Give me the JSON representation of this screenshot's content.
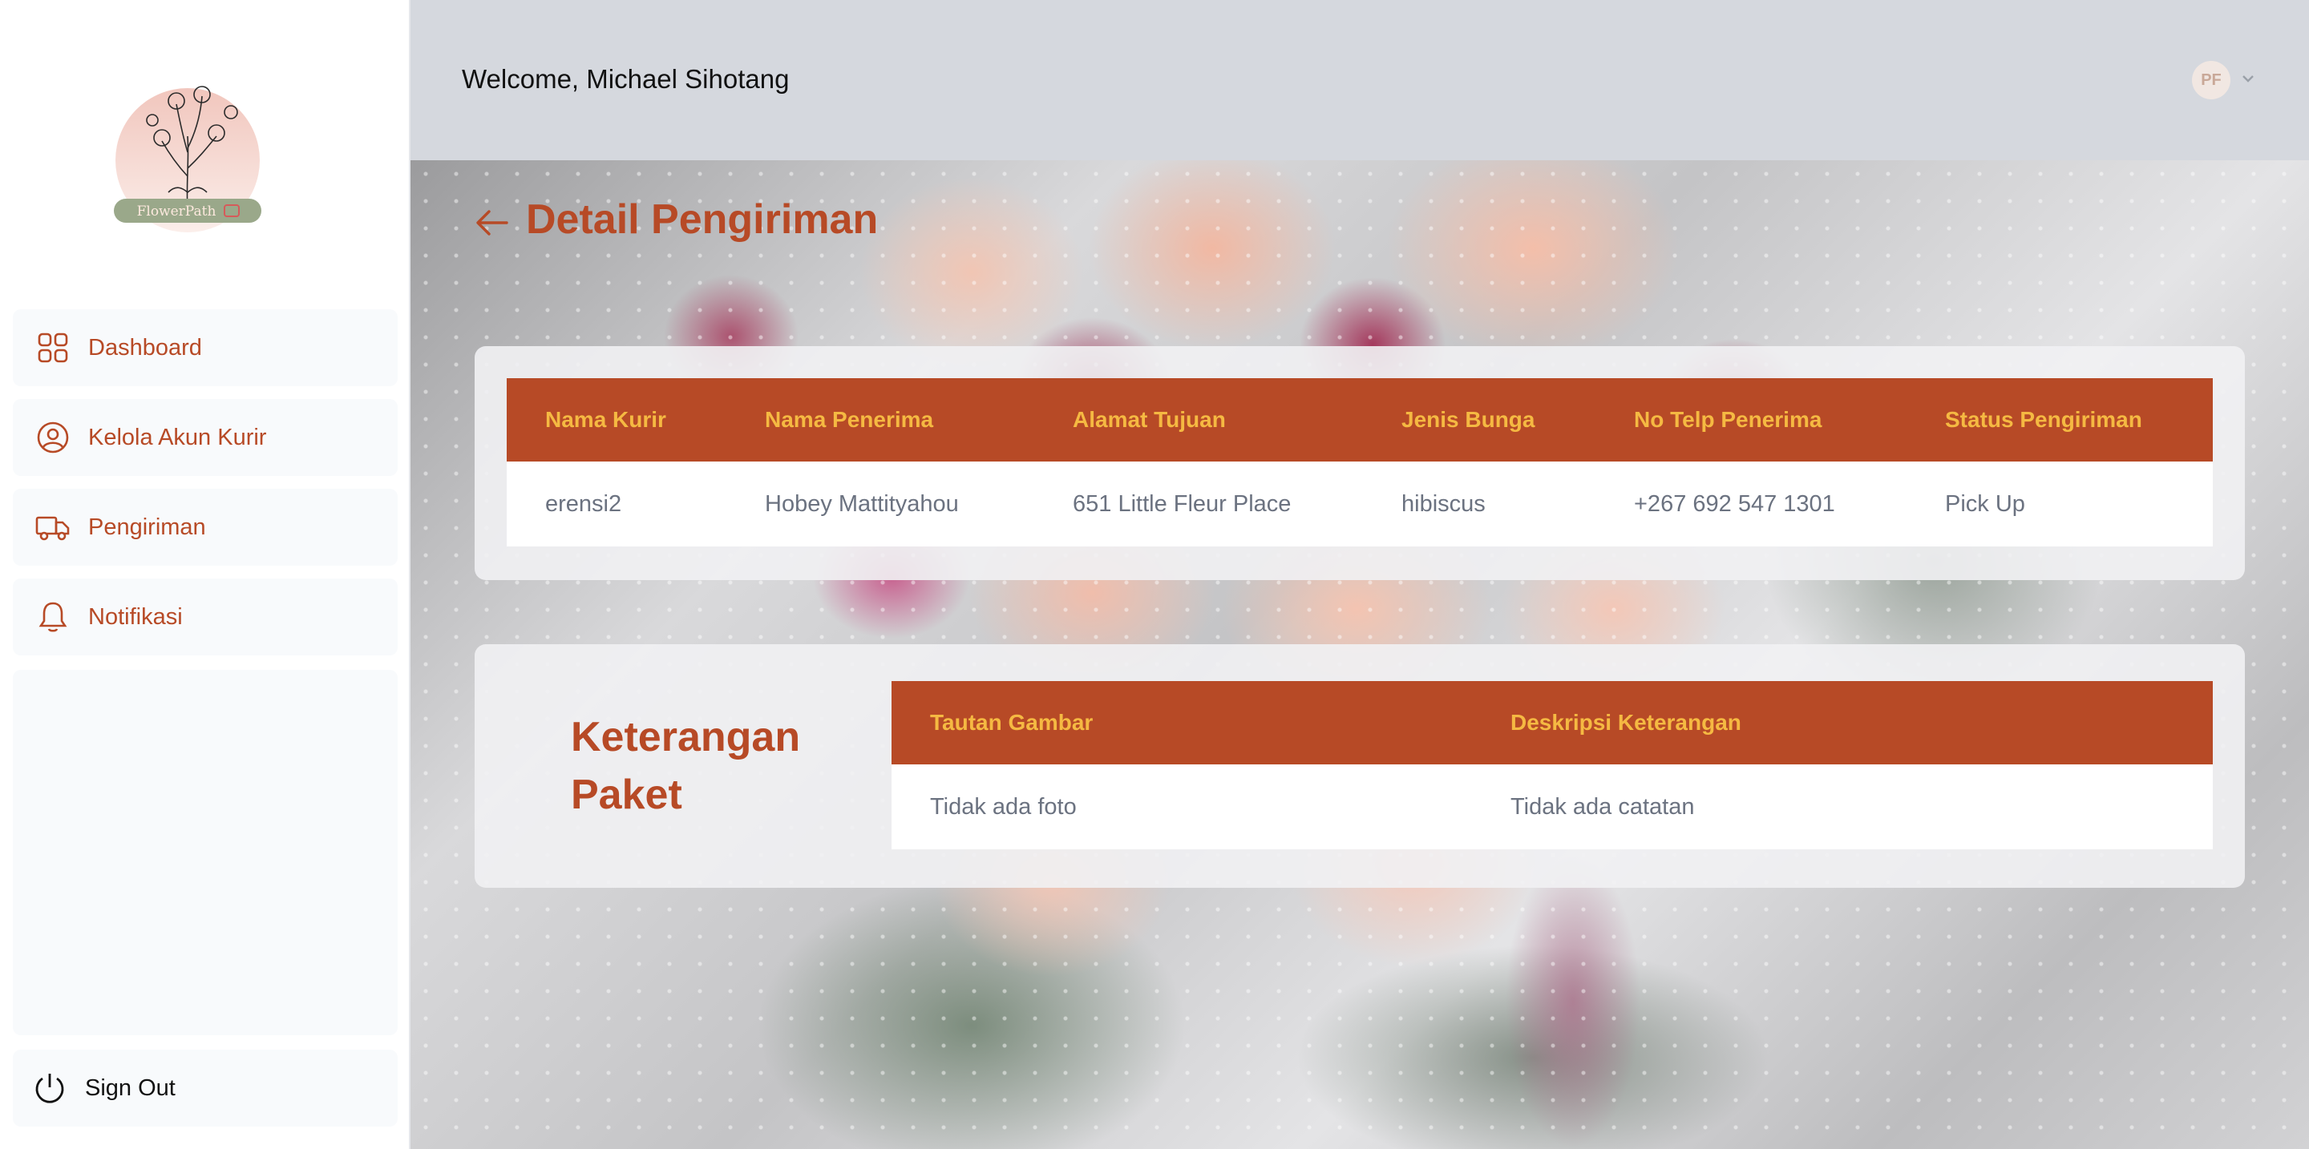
{
  "sidebar": {
    "logo_text": "FlowerPath",
    "items": [
      {
        "label": "Dashboard",
        "icon": "grid-icon"
      },
      {
        "label": "Kelola Akun Kurir",
        "icon": "user-circle-icon"
      },
      {
        "label": "Pengiriman",
        "icon": "truck-icon"
      },
      {
        "label": "Notifikasi",
        "icon": "bell-icon"
      }
    ],
    "signout_label": "Sign Out"
  },
  "header": {
    "welcome": "Welcome, Michael Sihotang",
    "avatar_initials": "PF"
  },
  "main": {
    "title": "Detail Pengiriman",
    "shipment_table": {
      "headers": [
        "Nama Kurir",
        "Nama Penerima",
        "Alamat Tujuan",
        "Jenis Bunga",
        "No Telp Penerima",
        "Status Pengiriman"
      ],
      "rows": [
        [
          "erensi2",
          "Hobey Mattityahou",
          "651 Little Fleur Place",
          "hibiscus",
          "+267 692 547 1301",
          "Pick Up"
        ]
      ]
    },
    "package": {
      "title": "Keterangan Paket",
      "headers": [
        "Tautan Gambar",
        "Deskripsi Keterangan"
      ],
      "rows": [
        [
          "Tidak ada foto",
          "Tidak ada catatan"
        ]
      ]
    }
  },
  "colors": {
    "accent": "#b74a26",
    "table_header_text": "#f5b942",
    "header_bg": "#d5d8de"
  }
}
